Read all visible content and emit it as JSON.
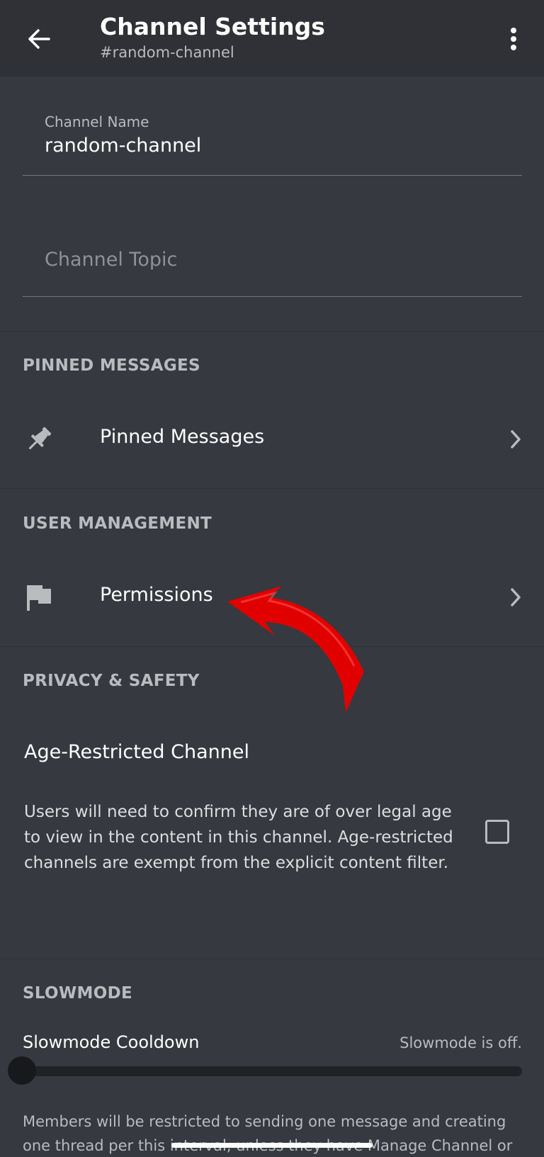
{
  "header": {
    "back_icon": "arrow-left-icon",
    "title": "Channel Settings",
    "subtitle": "#random-channel",
    "menu_icon": "more-vertical-icon"
  },
  "channel_name": {
    "label": "Channel Name",
    "value": "random-channel"
  },
  "channel_topic": {
    "placeholder": "Channel Topic",
    "value": ""
  },
  "pinned": {
    "section_title": "PINNED MESSAGES",
    "item": {
      "icon": "pin-icon",
      "label": "Pinned Messages"
    }
  },
  "user_management": {
    "section_title": "USER MANAGEMENT",
    "item": {
      "icon": "flag-icon",
      "label": "Permissions"
    }
  },
  "privacy": {
    "section_title": "PRIVACY & SAFETY",
    "age_title": "Age-Restricted Channel",
    "age_description": "Users will need to confirm they are of over legal age to view in the content in this channel. Age-restricted channels are exempt from the explicit content filter.",
    "age_checked": false
  },
  "slowmode": {
    "section_title": "SLOWMODE",
    "label": "Slowmode Cooldown",
    "status": "Slowmode is off.",
    "slider_value": 0,
    "description": "Members will be restricted to sending one message and creating one thread per this interval, unless they have Manage Channel or Manage"
  },
  "colors": {
    "background": "#36393f",
    "header_background": "#2f3136",
    "annotation_arrow": "#e00000"
  }
}
